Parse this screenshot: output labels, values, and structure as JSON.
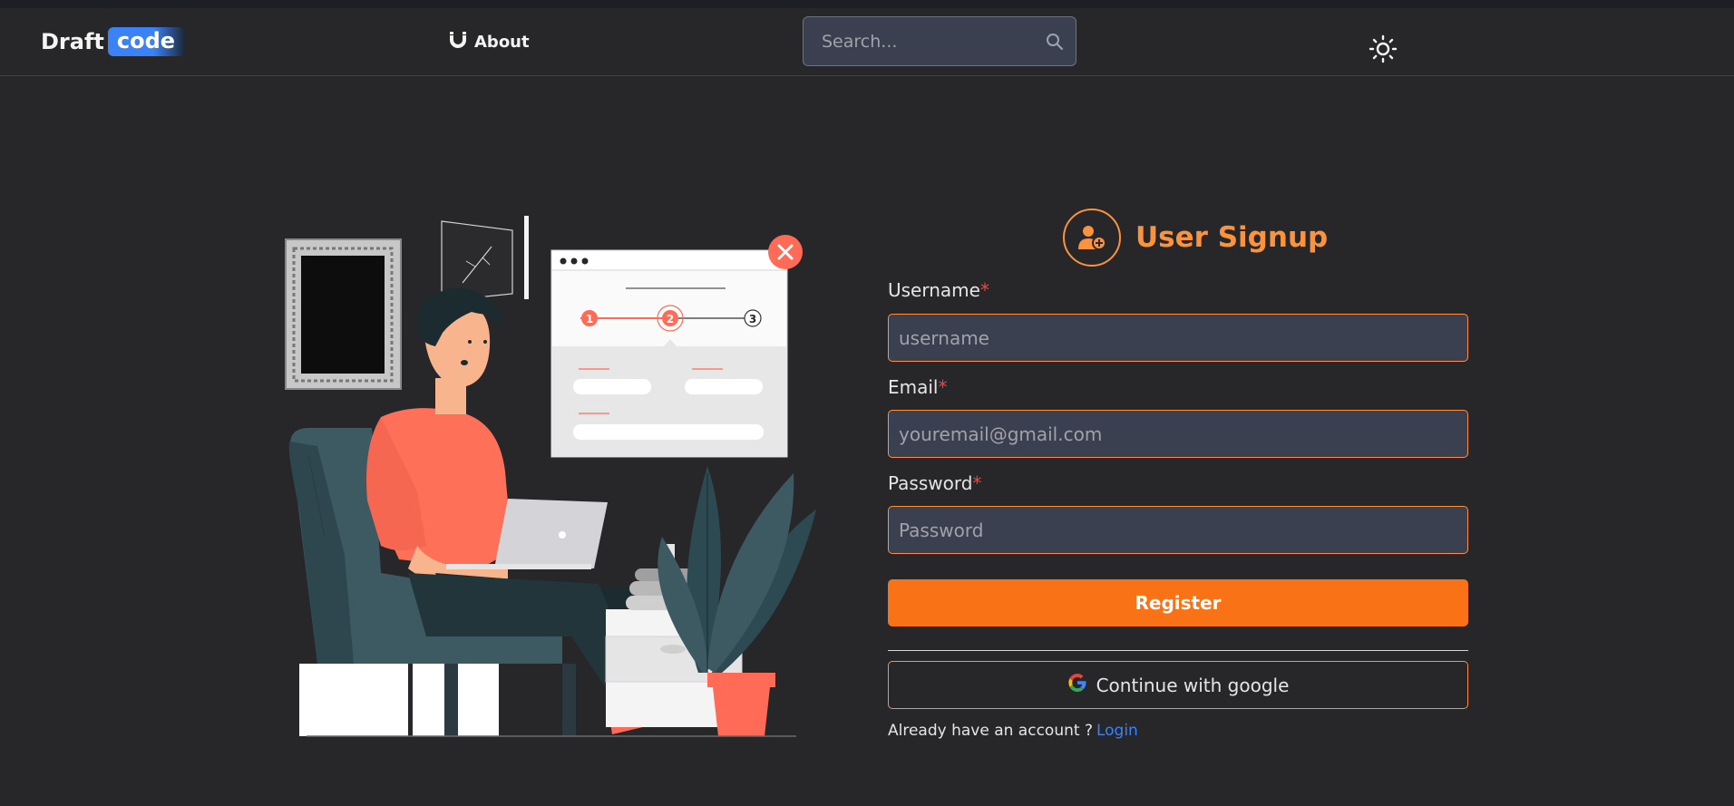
{
  "header": {
    "logo_part1": "Draft",
    "logo_part2": "code",
    "about_label": "About",
    "about_icon": "magnet-icon",
    "search_placeholder": "Search...",
    "search_icon": "search-icon",
    "theme_icon": "sun-icon"
  },
  "illustration": {
    "step1": "1",
    "step2": "2",
    "step3": "3"
  },
  "form": {
    "title": "User Signup",
    "title_icon": "user-plus-icon",
    "required_mark": "*",
    "username_label": "Username",
    "username_placeholder": "username",
    "email_label": "Email",
    "email_placeholder": "youremail@gmail.com",
    "password_label": "Password",
    "password_placeholder": "Password",
    "register_label": "Register",
    "google_label": "Continue with google",
    "google_icon": "google-icon",
    "login_prompt": "Already have an account ?",
    "login_link": "Login"
  },
  "colors": {
    "background": "#27272a",
    "accent_orange": "#f97316",
    "input_bg": "#3b4050",
    "link_blue": "#3b82f6",
    "required_red": "#ef4444"
  }
}
